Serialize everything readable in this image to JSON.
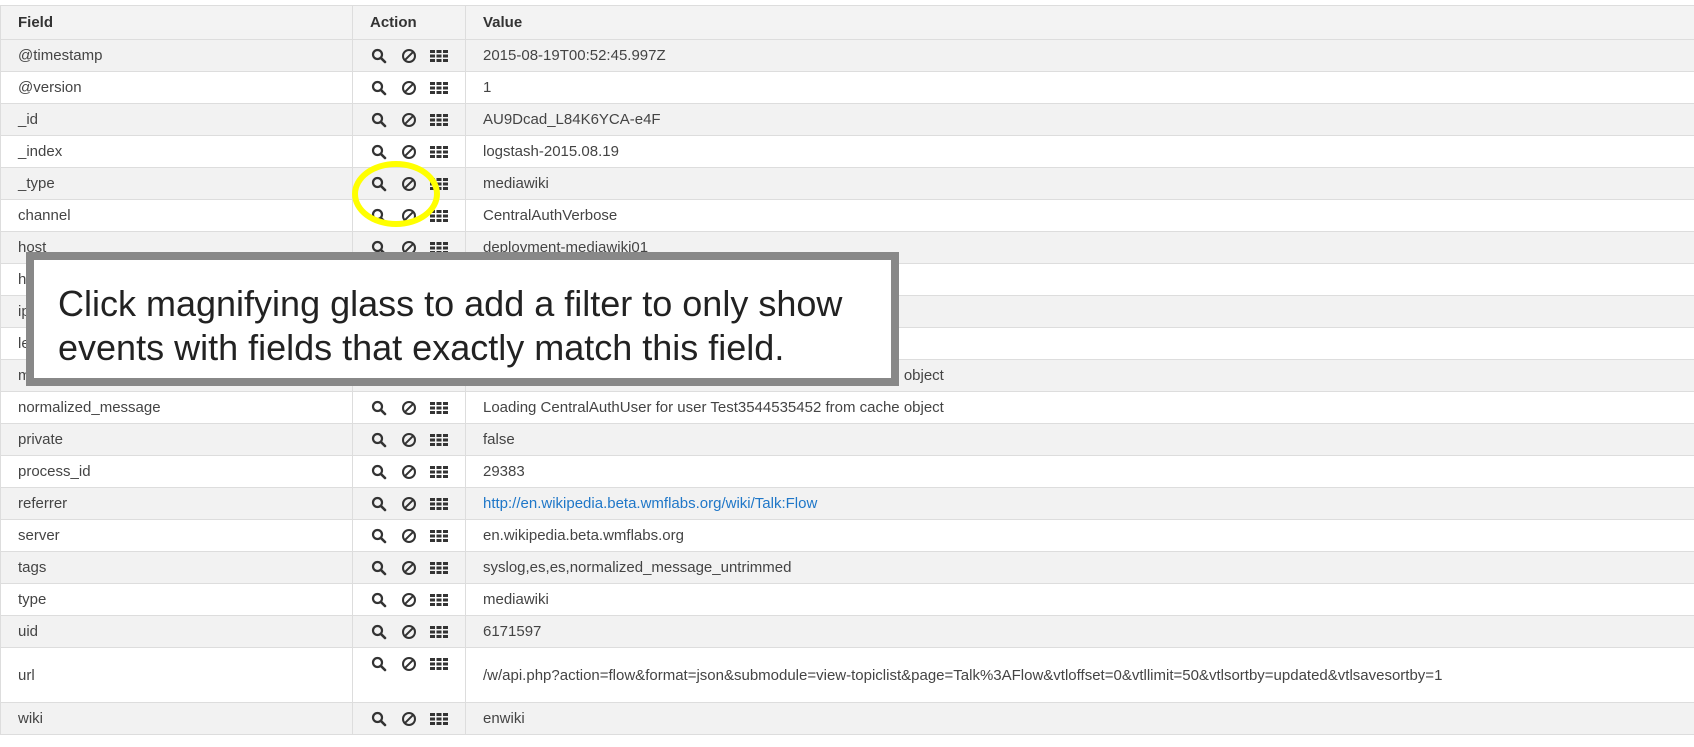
{
  "headers": {
    "field": "Field",
    "action": "Action",
    "value": "Value"
  },
  "rows": [
    {
      "field": "@timestamp",
      "value": "2015-08-19T00:52:45.997Z"
    },
    {
      "field": "@version",
      "value": "1"
    },
    {
      "field": "_id",
      "value": "AU9Dcad_L84K6YCA-e4F"
    },
    {
      "field": "_index",
      "value": "logstash-2015.08.19"
    },
    {
      "field": "_type",
      "value": "mediawiki"
    },
    {
      "field": "channel",
      "value": "CentralAuthVerbose"
    },
    {
      "field": "host",
      "value": "deployment-mediawiki01"
    },
    {
      "field": "h",
      "value": ""
    },
    {
      "field": "ip",
      "value": ""
    },
    {
      "field": "le",
      "value": ""
    },
    {
      "field": "m",
      "value": "Loading CentralAuthUser for user Test3544535452 from cache object"
    },
    {
      "field": "normalized_message",
      "value": "Loading CentralAuthUser for user Test3544535452 from cache object"
    },
    {
      "field": "private",
      "value": "false"
    },
    {
      "field": "process_id",
      "value": "29383"
    },
    {
      "field": "referrer",
      "value": "http://en.wikipedia.beta.wmflabs.org/wiki/Talk:Flow",
      "link": true
    },
    {
      "field": "server",
      "value": "en.wikipedia.beta.wmflabs.org"
    },
    {
      "field": "tags",
      "value": "syslog,es,es,normalized_message_untrimmed"
    },
    {
      "field": "type",
      "value": "mediawiki"
    },
    {
      "field": "uid",
      "value": "6171597"
    },
    {
      "field": "url",
      "value": "/w/api.php?action=flow&format=json&submodule=view-topiclist&page=Talk%3AFlow&vtloffset=0&vtllimit=50&vtlsortby=updated&vtlsavesortby=1",
      "tall": true
    },
    {
      "field": "wiki",
      "value": "enwiki"
    }
  ],
  "icons": [
    "magnifier-icon",
    "exclude-icon",
    "columns-icon"
  ],
  "callout_text": "Click magnifying glass to add a filter to only show events with fields that exactly match this field.",
  "colors": {
    "highlight": "#ffff00",
    "callout_border": "#888888",
    "link": "#1f77c8"
  }
}
